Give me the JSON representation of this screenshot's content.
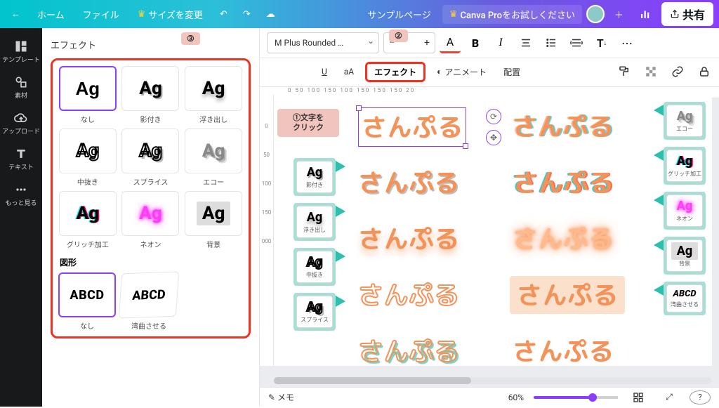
{
  "header": {
    "home": "ホーム",
    "file": "ファイル",
    "resize": "サイズを変更",
    "doc_title": "サンプルページ",
    "pro_cta": "Canva Proをお試しください",
    "share": "共有"
  },
  "leftnav": {
    "templates": "テンプレート",
    "elements": "素材",
    "upload": "アップロード",
    "text": "テキスト",
    "more": "もっと見る"
  },
  "panel": {
    "title": "エフェクト",
    "effects": [
      {
        "label": "なし"
      },
      {
        "label": "影付き"
      },
      {
        "label": "浮き出し"
      },
      {
        "label": "中抜き"
      },
      {
        "label": "スプライス"
      },
      {
        "label": "エコー"
      },
      {
        "label": "グリッチ加工"
      },
      {
        "label": "ネオン"
      },
      {
        "label": "背景"
      }
    ],
    "shapes_title": "図形",
    "shapes": [
      {
        "label": "なし",
        "sample": "ABCD"
      },
      {
        "label": "湾曲させる",
        "sample": "ABCD"
      }
    ]
  },
  "toolbar": {
    "font": "M Plus Rounded …",
    "size_hidden": "",
    "bold": "B",
    "italic": "I",
    "underline": "U",
    "case": "aA",
    "effects": "エフェクト",
    "animate": "アニメート",
    "position": "配置"
  },
  "ruler_marks": "0     50     100     150     100     150     150     150     20",
  "vruler": [
    "0",
    "50",
    "100",
    "150",
    "000"
  ],
  "callouts": {
    "step1": "①文字を\nクリック",
    "step2": "②",
    "step3": "③"
  },
  "sample_text": "さんぷる",
  "mini_left": [
    {
      "label": "影付き",
      "cls": "t-shadow"
    },
    {
      "label": "浮き出し",
      "cls": "t-lift"
    },
    {
      "label": "中抜き",
      "cls": "t-hollow"
    },
    {
      "label": "スプライス",
      "cls": "t-splice"
    }
  ],
  "mini_right": [
    {
      "label": "エコー",
      "cls": "t-echo"
    },
    {
      "label": "グリッチ加工",
      "cls": "t-glitch"
    },
    {
      "label": "ネオン",
      "cls": "t-neon"
    },
    {
      "label": "背景",
      "cls": "t-bg"
    },
    {
      "label": "湾曲させる",
      "cls": "",
      "text": "ABCD"
    }
  ],
  "status": {
    "notes": "メモ",
    "zoom": "60%"
  }
}
